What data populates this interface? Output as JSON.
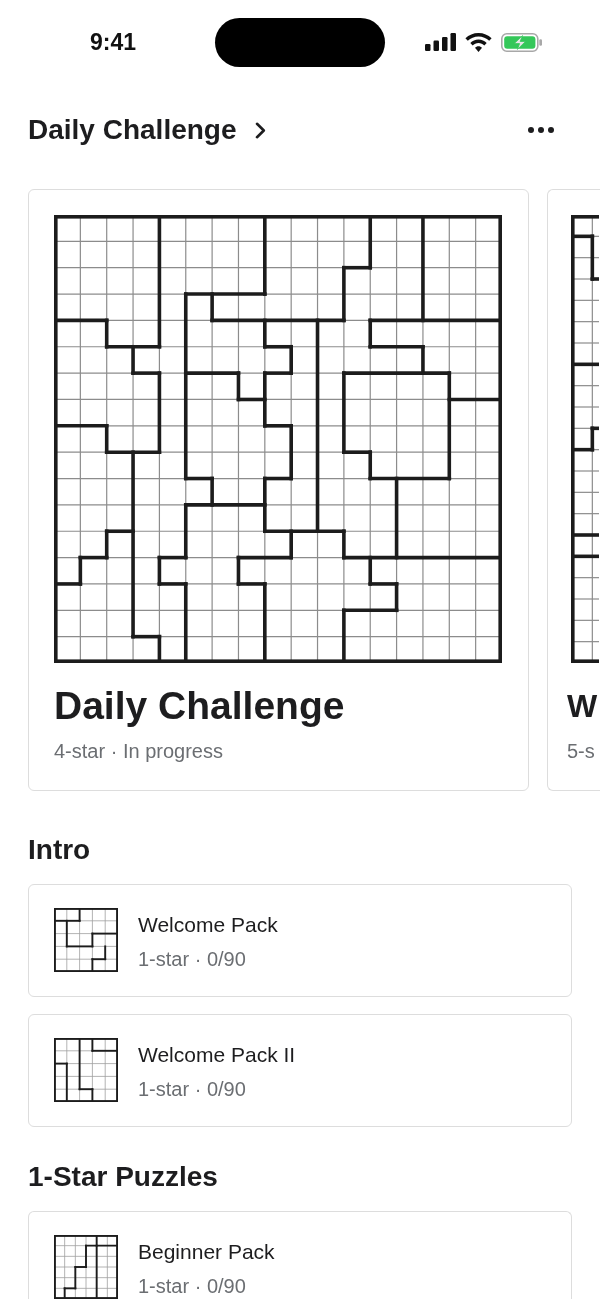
{
  "status_bar": {
    "time": "9:41"
  },
  "header": {
    "title": "Daily Challenge"
  },
  "carousel": [
    {
      "title": "Daily Challenge",
      "subtitle": "4-star · In progress"
    },
    {
      "title": "W",
      "subtitle": "5-s"
    }
  ],
  "sections": [
    {
      "title": "Intro",
      "packs": [
        {
          "name": "Welcome Pack",
          "subtitle": "1-star · 0/90"
        },
        {
          "name": "Welcome Pack II",
          "subtitle": "1-star · 0/90"
        }
      ]
    },
    {
      "title": "1-Star Puzzles",
      "packs": [
        {
          "name": "Beginner Pack",
          "subtitle": "1-star · 0/90"
        }
      ]
    }
  ]
}
